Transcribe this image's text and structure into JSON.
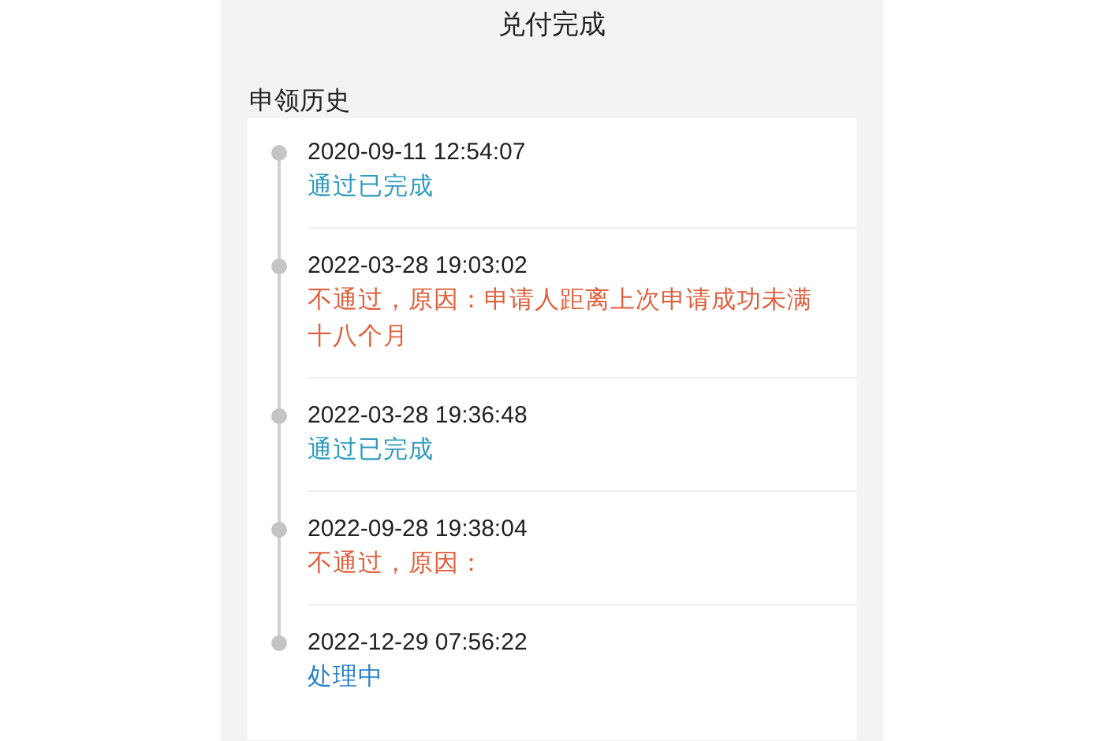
{
  "header": {
    "title": "兑付完成"
  },
  "history": {
    "heading": "申领历史",
    "entries": [
      {
        "time": "2020-09-11 12:54:07",
        "status": "通过已完成",
        "kind": "passed"
      },
      {
        "time": "2022-03-28 19:03:02",
        "status": "不通过，原因：申请人距离上次申请成功未满十八个月",
        "kind": "rejected"
      },
      {
        "time": "2022-03-28 19:36:48",
        "status": "通过已完成",
        "kind": "passed"
      },
      {
        "time": "2022-09-28 19:38:04",
        "status": "不通过，原因：",
        "kind": "rejected"
      },
      {
        "time": "2022-12-29 07:56:22",
        "status": "处理中",
        "kind": "processing"
      }
    ]
  }
}
